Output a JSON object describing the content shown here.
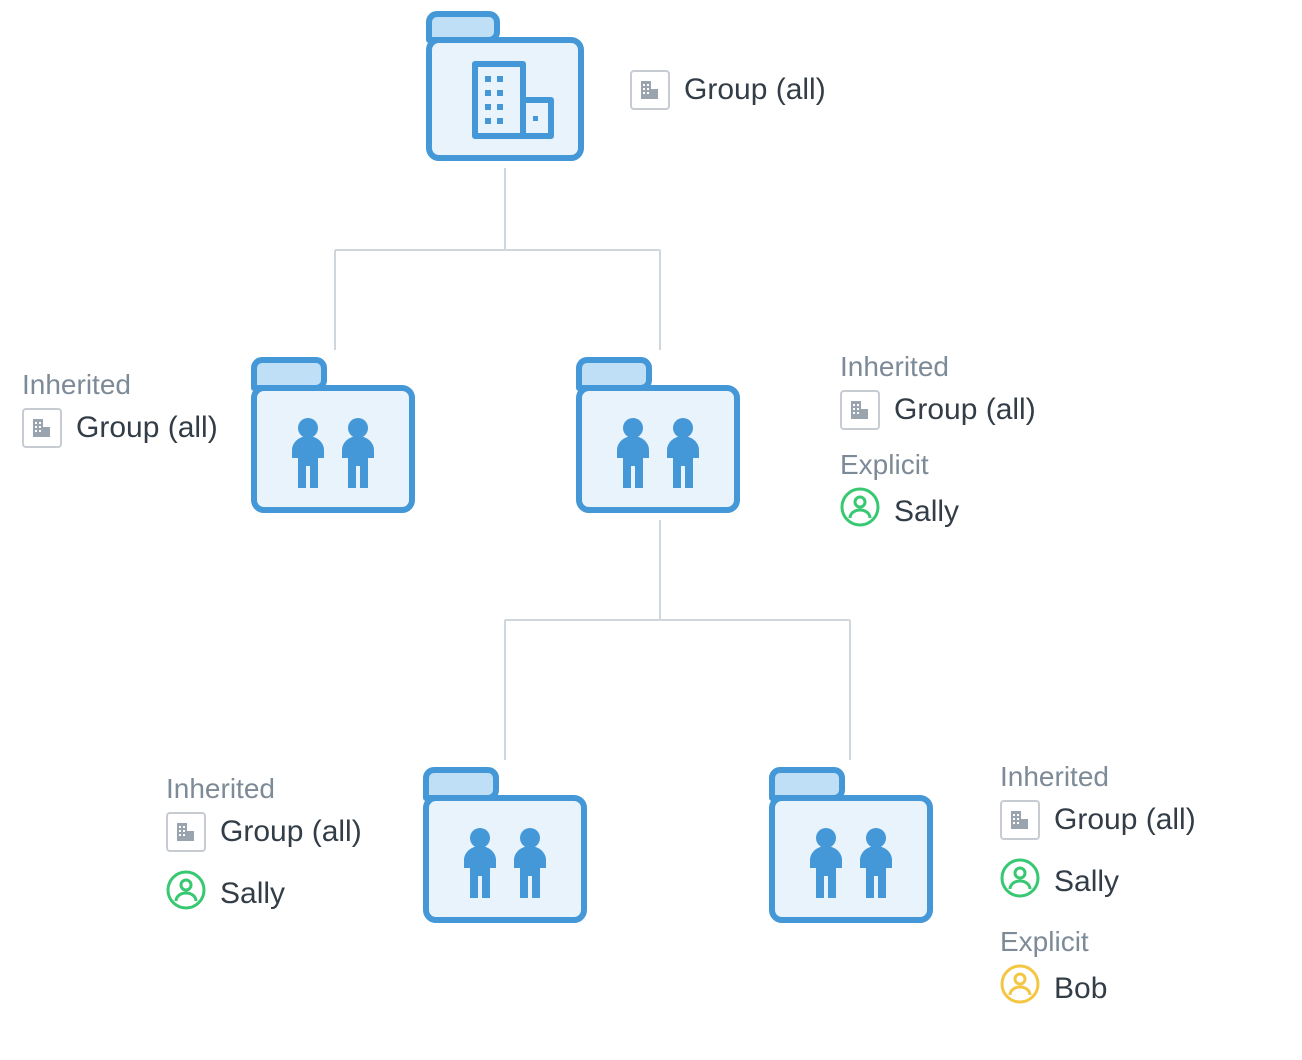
{
  "labels": {
    "inherited": "Inherited",
    "explicit": "Explicit",
    "group_all": "Group (all)",
    "sally": "Sally",
    "bob": "Bob"
  },
  "colors": {
    "folder_stroke": "#4598d8",
    "folder_fill_light": "#e9f3fb",
    "folder_fill_tab": "#bedff5",
    "icon_blue": "#4598d8",
    "grey_text": "#7d8a97",
    "dark_text": "#333d47",
    "grey_box": "#c6ccd2",
    "grey_glyph": "#9aa4ae",
    "connector": "#cfd6dc",
    "user_green": "#37c871",
    "user_yellow": "#f4c643"
  },
  "icons": {
    "org_folder": "org-folder-icon",
    "people_folder": "people-folder-icon",
    "building": "building-icon",
    "user_green": "user-green-icon",
    "user_yellow": "user-yellow-icon"
  },
  "nodes": {
    "root": {
      "type": "org"
    },
    "mid_left": {
      "type": "people"
    },
    "mid_right": {
      "type": "people"
    },
    "leaf_left": {
      "type": "people"
    },
    "leaf_right": {
      "type": "people"
    }
  },
  "annotations": {
    "root_right": [
      {
        "section": null,
        "items": [
          {
            "icon": "building",
            "text_key": "group_all"
          }
        ]
      }
    ],
    "mid_left_side": [
      {
        "section": "inherited",
        "items": [
          {
            "icon": "building",
            "text_key": "group_all"
          }
        ]
      }
    ],
    "mid_right_side": [
      {
        "section": "inherited",
        "items": [
          {
            "icon": "building",
            "text_key": "group_all"
          }
        ]
      },
      {
        "section": "explicit",
        "items": [
          {
            "icon": "user_green",
            "text_key": "sally"
          }
        ]
      }
    ],
    "leaf_left_side": [
      {
        "section": "inherited",
        "items": [
          {
            "icon": "building",
            "text_key": "group_all"
          },
          {
            "icon": "user_green",
            "text_key": "sally"
          }
        ]
      }
    ],
    "leaf_right_side": [
      {
        "section": "inherited",
        "items": [
          {
            "icon": "building",
            "text_key": "group_all"
          },
          {
            "icon": "user_green",
            "text_key": "sally"
          }
        ]
      },
      {
        "section": "explicit",
        "items": [
          {
            "icon": "user_yellow",
            "text_key": "bob"
          }
        ]
      }
    ]
  }
}
